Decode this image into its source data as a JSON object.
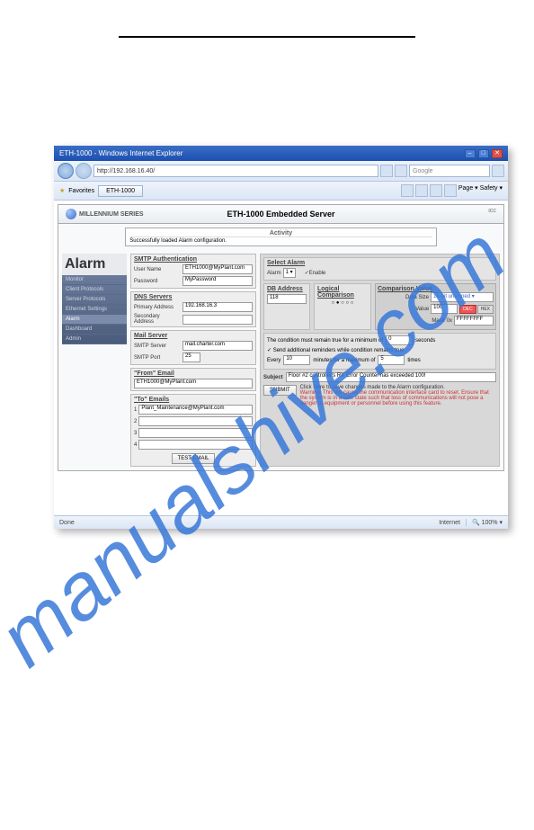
{
  "window": {
    "title": "ETH-1000 - Windows Internet Explorer",
    "min": "–",
    "max": "□",
    "close": "✕"
  },
  "addr": {
    "url": "http://192.168.16.40/",
    "search": "Google",
    "favorites": "Favorites",
    "tab": "ETH-1000",
    "page": "Page ▾",
    "safety": "Safety ▾"
  },
  "header": {
    "brand": "MILLENNIUM SERIES",
    "title": "ETH-1000 Embedded Server",
    "activity_title": "Activity",
    "activity_msg": "Successfully loaded Alarm configuration.",
    "icc": "ICC"
  },
  "sidebar": {
    "title": "Alarm",
    "items": [
      "Monitor",
      "Client Protocols",
      "Server Protocols",
      "Ethernet Settings",
      "Alarm",
      "Dashboard",
      "Admin"
    ],
    "active": 4
  },
  "smtp": {
    "title": "SMTP Authentication",
    "user_label": "User Name",
    "user": "ETH1000@MyPlant.com",
    "pass_label": "Password",
    "pass": "MyPassword"
  },
  "dns": {
    "title": "DNS Servers",
    "primary_label": "Primary Address",
    "primary": "192.168.16.3",
    "secondary_label": "Secondary Address",
    "secondary": ""
  },
  "mail": {
    "title": "Mail Server",
    "server_label": "SMTP Server",
    "server": "mail.charter.com",
    "port_label": "SMTP Port",
    "port": "25"
  },
  "from": {
    "title": "\"From\" Email",
    "value": "ETH1000@MyPlant.com"
  },
  "to": {
    "title": "\"To\" Emails",
    "n1": "1",
    "n2": "2",
    "n3": "3",
    "n4": "4",
    "e1": "Plant_Maintenance@MyPlant.com",
    "e2": "",
    "e3": "",
    "e4": "",
    "test": "TEST EMAIL"
  },
  "select": {
    "title": "Select Alarm",
    "alarm_label": "Alarm",
    "alarm_val": "1 ▾",
    "enable": "✓Enable"
  },
  "db": {
    "title": "DB Address",
    "value": "118"
  },
  "logic": {
    "title": "Logical Comparison",
    "op": "<"
  },
  "comp": {
    "title": "Comparison Value",
    "datasize_label": "Data Size",
    "datasize": "16-bit unsigned ▾",
    "value_label": "Value",
    "value": "100",
    "mask_label": "Mask",
    "mask": "0x",
    "mask_val": "FFFFFFFF",
    "dec": "DEC",
    "hex": "HEX"
  },
  "cond": {
    "line1a": "The condition must remain true for a minimum of",
    "line1b": "seconds",
    "v1": "0",
    "cb": "✓ Send additional reminders while condition remains true",
    "every": "Every",
    "v2": "10",
    "mid": "minutes for a maximum of",
    "v3": "5",
    "times": "times"
  },
  "subj": {
    "label": "Subject",
    "value": "Floor #2 controller's RX Error Counter has exceeded 100!"
  },
  "submit": {
    "btn": "SUBMIT",
    "msg": "Click Here to save changes made to the Alarm configuration.",
    "warn": "Warning: This will cause the communication interface card to reset. Ensure that the system is in a safe state such that loss of communications will not pose a danger to equipment or personnel before using this feature."
  },
  "status": {
    "done": "Done",
    "internet": "Internet",
    "zoom": "100%"
  }
}
